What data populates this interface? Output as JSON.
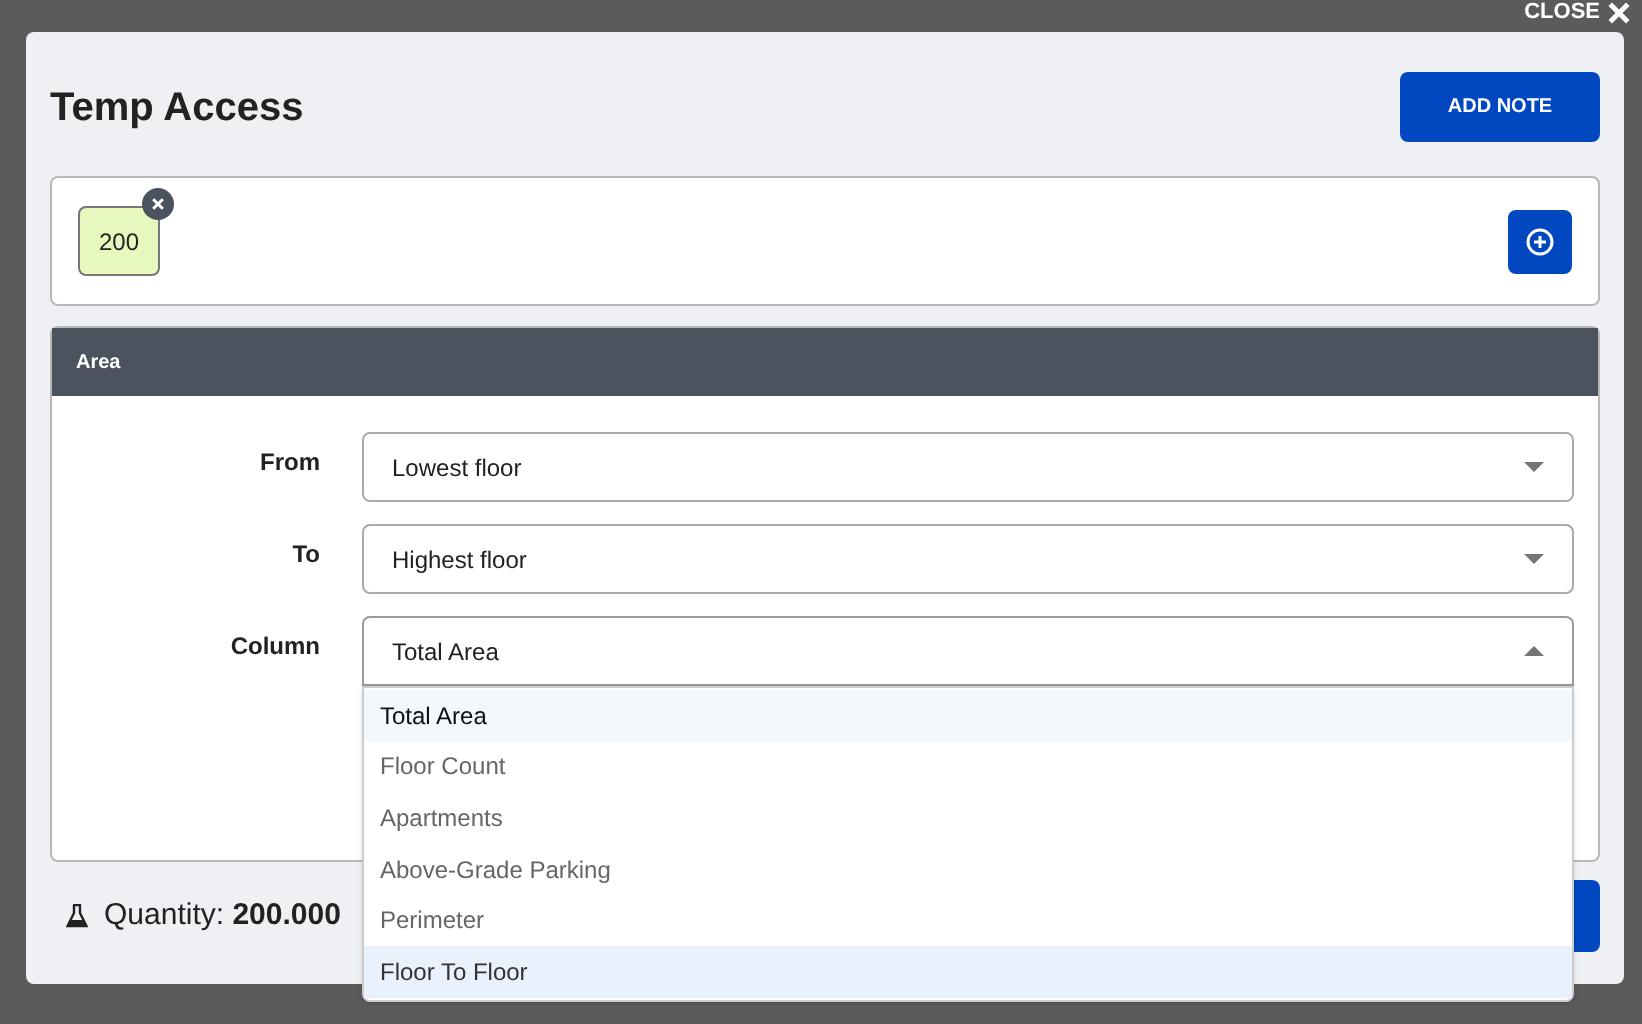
{
  "close": {
    "label": "CLOSE"
  },
  "dialog": {
    "title": "Temp Access",
    "add_note": "ADD NOTE"
  },
  "tags": [
    {
      "label": "200"
    }
  ],
  "panel": {
    "title": "Area",
    "fields": [
      {
        "label": "From",
        "value": "Lowest floor",
        "expanded": false
      },
      {
        "label": "To",
        "value": "Highest floor",
        "expanded": false
      },
      {
        "label": "Column",
        "value": "Total Area",
        "expanded": true
      }
    ]
  },
  "dropdown": [
    {
      "label": "Total Area",
      "selected": true,
      "hovered": false
    },
    {
      "label": "Floor Count",
      "selected": false,
      "hovered": false
    },
    {
      "label": "Apartments",
      "selected": false,
      "hovered": false
    },
    {
      "label": "Above-Grade Parking",
      "selected": false,
      "hovered": false
    },
    {
      "label": "Perimeter",
      "selected": false,
      "hovered": false
    },
    {
      "label": "Floor To Floor",
      "selected": false,
      "hovered": true
    }
  ],
  "footer": {
    "quantity_label": "Quantity:",
    "quantity_value": "200.000"
  }
}
